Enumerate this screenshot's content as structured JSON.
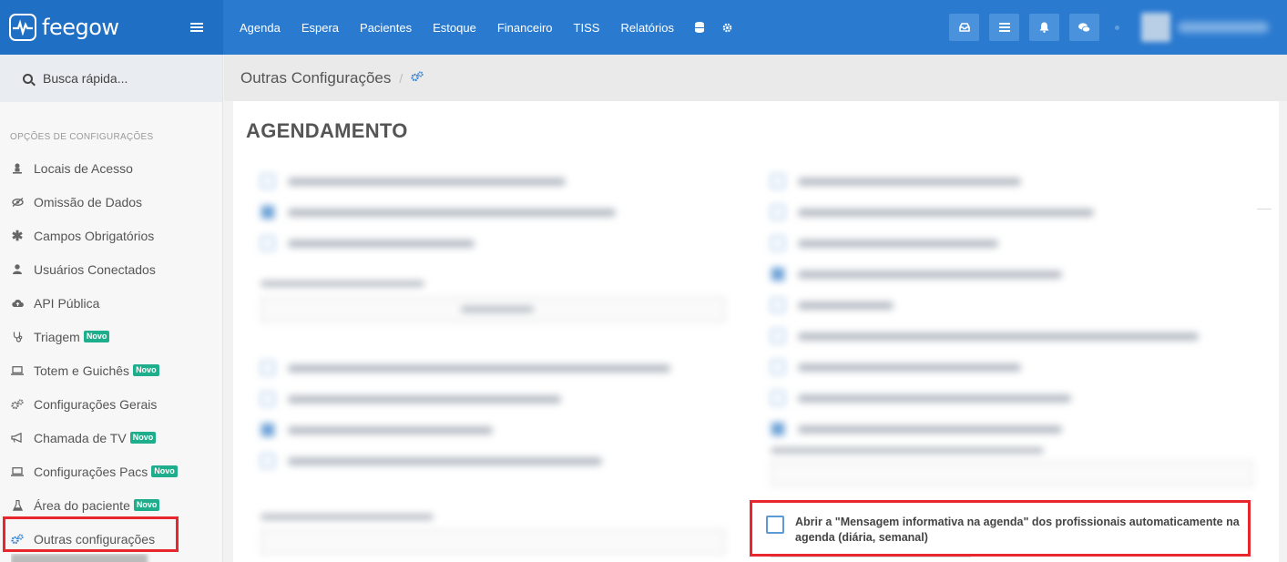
{
  "brand": {
    "name": "feegow"
  },
  "nav": {
    "items": [
      "Agenda",
      "Espera",
      "Pacientes",
      "Estoque",
      "Financeiro",
      "TISS",
      "Relatórios"
    ],
    "icons": [
      "database-icon",
      "gear-icon"
    ]
  },
  "topbar_right": {
    "buttons": [
      "inbox-icon",
      "list-icon",
      "bell-icon",
      "chat-icon"
    ]
  },
  "sidebar": {
    "search_placeholder": "Busca rápida...",
    "section_title": "OPÇÕES DE CONFIGURAÇÕES",
    "badge_label": "Novo",
    "items": [
      {
        "label": "Locais de Acesso",
        "icon": "user-pin-icon",
        "badge": false
      },
      {
        "label": "Omissão de Dados",
        "icon": "eye-slash-icon",
        "badge": false
      },
      {
        "label": "Campos Obrigatórios",
        "icon": "asterisk-icon",
        "badge": false
      },
      {
        "label": "Usuários Conectados",
        "icon": "user-icon",
        "badge": false
      },
      {
        "label": "API Pública",
        "icon": "cloud-icon",
        "badge": false
      },
      {
        "label": "Triagem",
        "icon": "stethoscope-icon",
        "badge": true
      },
      {
        "label": "Totem e Guichês",
        "icon": "laptop-icon",
        "badge": true
      },
      {
        "label": "Configurações Gerais",
        "icon": "cogs-icon",
        "badge": false
      },
      {
        "label": "Chamada de TV",
        "icon": "bullhorn-icon",
        "badge": true
      },
      {
        "label": "Configurações Pacs",
        "icon": "laptop-icon",
        "badge": true
      },
      {
        "label": "Área do paciente",
        "icon": "flask-icon",
        "badge": true
      },
      {
        "label": "Outras configurações",
        "icon": "cogs-icon",
        "badge": false,
        "active": true
      }
    ]
  },
  "breadcrumb": {
    "title": "Outras Configurações",
    "separator": "/"
  },
  "main": {
    "section_title": "AGENDAMENTO",
    "highlighted_option": {
      "label": "Abrir a \"Mensagem informativa na agenda\" dos profissionais automaticamente na agenda (diária, semanal)",
      "checked": false
    }
  },
  "colors": {
    "primary": "#2a7ad0",
    "badge": "#1fae8c",
    "highlight": "#e8262d"
  }
}
